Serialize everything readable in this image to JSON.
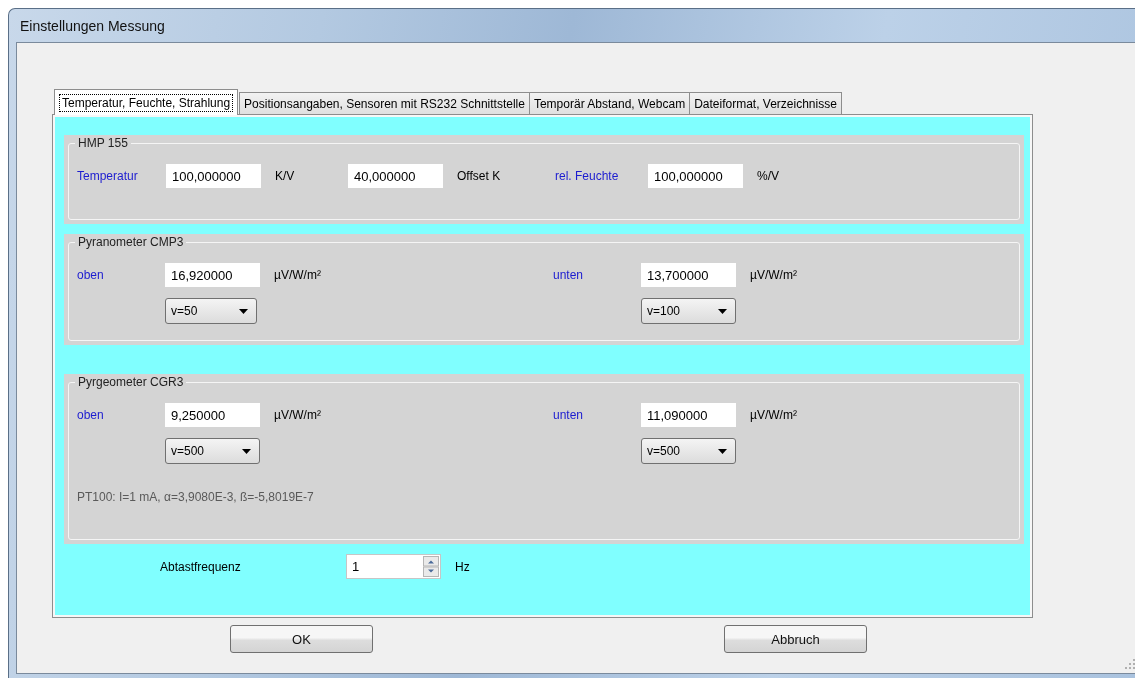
{
  "window": {
    "title": "Einstellungen Messung"
  },
  "tabs": [
    {
      "label": "Temperatur, Feuchte, Strahlung",
      "selected": true
    },
    {
      "label": "Positionsangaben, Sensoren mit RS232 Schnittstelle",
      "selected": false
    },
    {
      "label": "Temporär Abstand, Webcam",
      "selected": false
    },
    {
      "label": "Dateiformat, Verzeichnisse",
      "selected": false
    }
  ],
  "hmp": {
    "legend": "HMP 155",
    "fields": [
      {
        "label": "Temperatur",
        "value": "100,000000",
        "unit": "K/V"
      },
      {
        "value": "40,000000",
        "unit": "Offset K"
      },
      {
        "label": "rel. Feuchte",
        "value": "100,000000",
        "unit": "%/V"
      }
    ]
  },
  "groups": [
    {
      "legend": "Pyranometer CMP3",
      "sensors": [
        {
          "label": "oben",
          "value": "16,920000",
          "unit": "µV/W/m²",
          "gain": "v=50"
        },
        {
          "label": "unten",
          "value": "13,700000",
          "unit": "µV/W/m²",
          "gain": "v=100"
        }
      ]
    },
    {
      "legend": "Pyrgeometer CGR3",
      "sensors": [
        {
          "label": "oben",
          "value": "9,250000",
          "unit": "µV/W/m²",
          "gain": "v=500"
        },
        {
          "label": "unten",
          "value": "11,090000",
          "unit": "µV/W/m²",
          "gain": "v=500"
        }
      ],
      "note": "PT100: I=1 mA, α=3,9080E-3, ß=-5,8019E-7"
    }
  ],
  "sampling": {
    "label": "Abtastfrequenz",
    "value": "1",
    "unit": "Hz"
  },
  "buttons": [
    "OK",
    "Abbruch"
  ]
}
